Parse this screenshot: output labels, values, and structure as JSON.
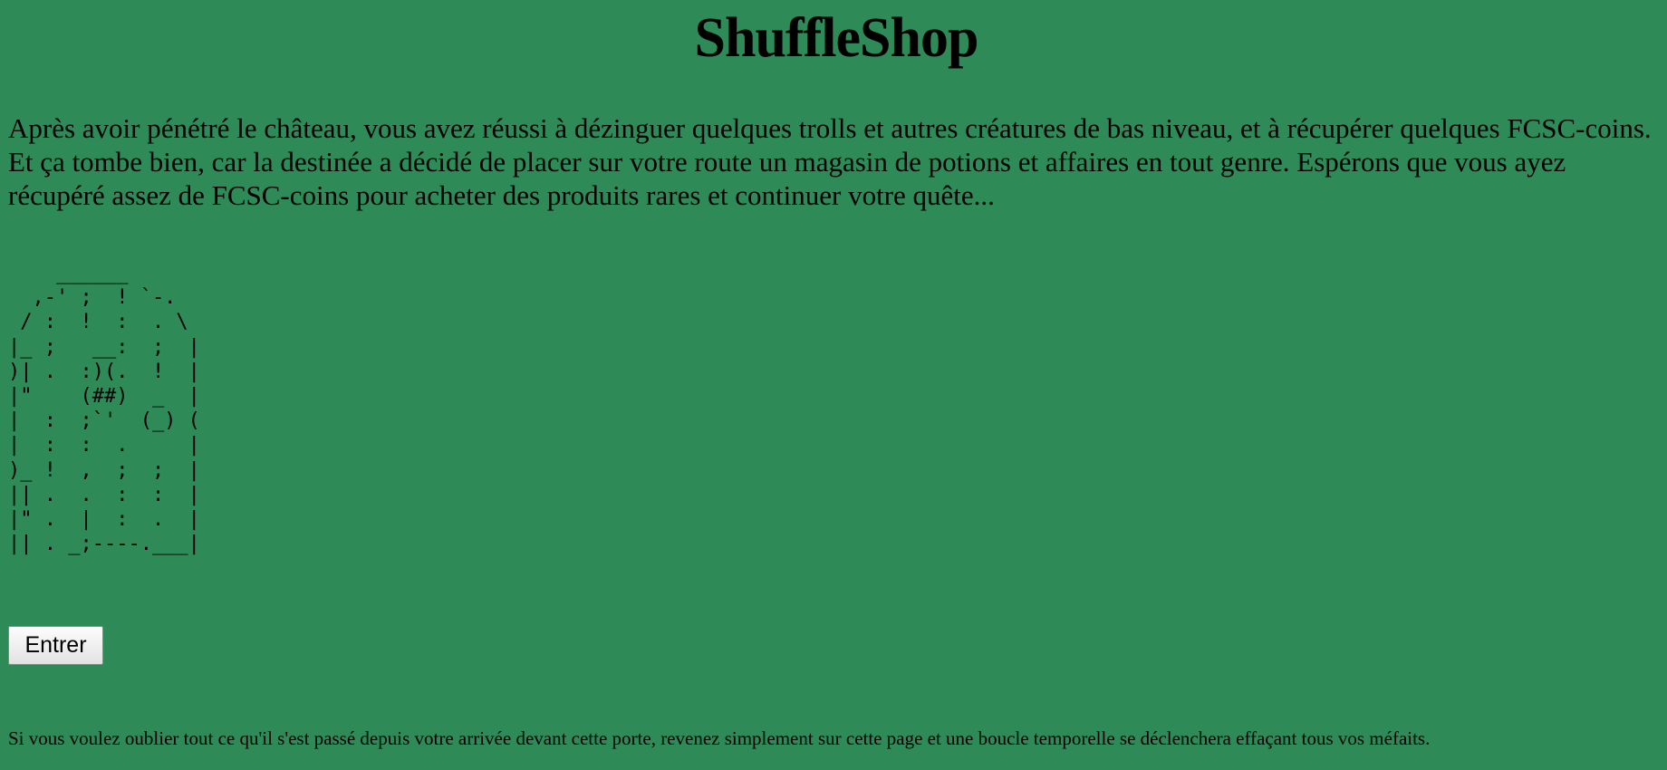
{
  "page": {
    "background_color": "#2e8b57",
    "text_color": "#000000"
  },
  "header": {
    "title": "ShuffleShop"
  },
  "main": {
    "intro": "Après avoir pénétré le château, vous avez réussi à dézinguer quelques trolls et autres créatures de bas niveau, et à récupérer quelques FCSC-coins. Et ça tombe bien, car la destinée a décidé de placer sur votre route un magasin de potions et affaires en tout genre. Espérons que vous ayez récupéré assez de FCSC-coins pour acheter des produits rares et continuer votre quête...",
    "ascii_door": "    ______\n  ,-' ;  ! `-.\n / :  !  :  . \\\n|_ ;   __:  ;  |\n)| .  :)(.  !  |\n|\"    (##)  _  |\n|  :  ;`'  (_) (\n|  :  :  .     |\n)_ !  ,  ;  ;  |\n|| .  .  :  :  |\n|\" .  |  :  .  |\n|| . _;----.___|",
    "enter_button_label": "Entrer"
  },
  "footer": {
    "note": "Si vous voulez oublier tout ce qu'il s'est passé depuis votre arrivée devant cette porte, revenez simplement sur cette page et une boucle temporelle se déclenchera effaçant tous vos méfaits."
  }
}
